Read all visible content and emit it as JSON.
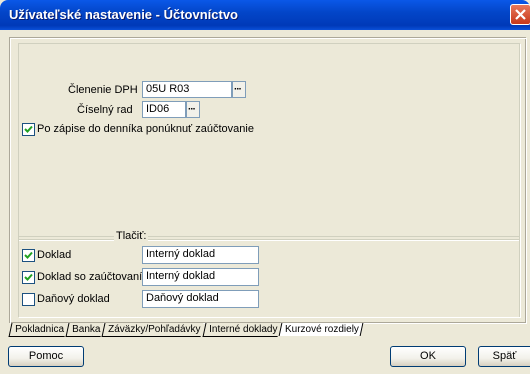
{
  "window": {
    "title": "Užívateľské nastavenie - Účtovníctvo"
  },
  "settings": {
    "clenenie_label": "Členenie DPH",
    "clenenie_value": "05U R03",
    "ciselny_label": "Číselný rad",
    "ciselny_value": "ID06",
    "zapis_label": "Po zápise do denníka ponúknuť zaúčtovanie",
    "zapis_checked": true
  },
  "print": {
    "title": "Tlačiť:",
    "rows": [
      {
        "label": "Doklad",
        "checked": true,
        "value": "Interný doklad"
      },
      {
        "label": "Doklad so zaúčtovaním",
        "checked": true,
        "value": "Interný doklad"
      },
      {
        "label": "Daňový doklad",
        "checked": false,
        "value": "Daňový doklad"
      }
    ]
  },
  "tabs": [
    "Pokladnica",
    "Banka",
    "Záväzky/Pohľadávky",
    "Interné doklady",
    "Kurzové rozdiely"
  ],
  "active_tab": 4,
  "buttons": {
    "help": "Pomoc",
    "ok": "OK",
    "close": "Späť"
  },
  "icons": {
    "close": "close-x-icon",
    "ellipsis": "ellipsis-icon",
    "check": "checkmark-icon"
  }
}
